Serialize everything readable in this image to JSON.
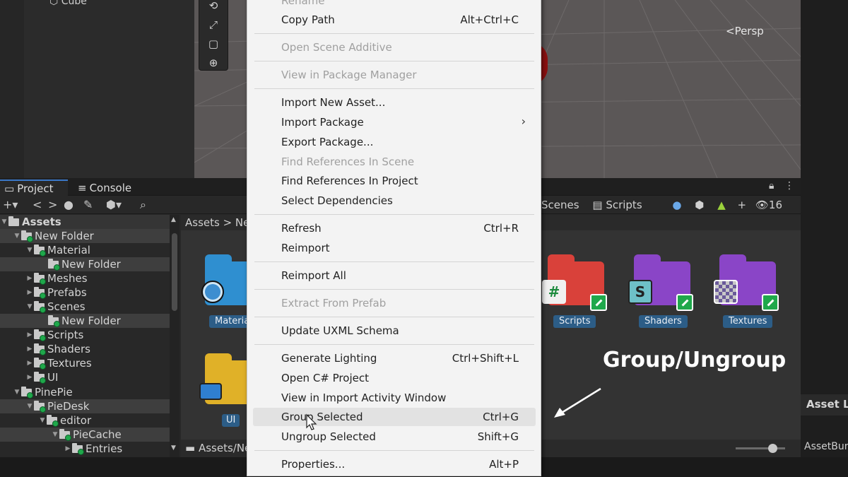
{
  "hierarchy": {
    "object": "Cube"
  },
  "scene": {
    "view_label": "<Persp",
    "tools": [
      "rotate-icon",
      "scale-icon",
      "rect-icon",
      "transform-icon"
    ]
  },
  "tabs": {
    "project": "Project",
    "console": "Console"
  },
  "toolbar": {
    "add": "+▾",
    "back": "<",
    "forward": ">",
    "hidden_count": "16"
  },
  "tree": {
    "items": [
      {
        "label": "Assets"
      },
      {
        "label": "New Folder"
      },
      {
        "label": "Material"
      },
      {
        "label": "New Folder"
      },
      {
        "label": "Meshes"
      },
      {
        "label": "Prefabs"
      },
      {
        "label": "Scenes"
      },
      {
        "label": "New Folder"
      },
      {
        "label": "Scripts"
      },
      {
        "label": "Shaders"
      },
      {
        "label": "Textures"
      },
      {
        "label": "UI"
      },
      {
        "label": "PinePie"
      },
      {
        "label": "PieDesk"
      },
      {
        "label": "editor"
      },
      {
        "label": "PieCache"
      },
      {
        "label": "Entries"
      }
    ]
  },
  "assets": {
    "breadcrumb": "Assets  >  Ne",
    "filters": {
      "scenes": "Scenes",
      "scripts": "Scripts"
    },
    "bottom_path": "Assets/Ne",
    "folders": [
      {
        "label": "Materia",
        "color": "#2f8fd0"
      },
      {
        "label": "Scripts",
        "color": "#d9413a"
      },
      {
        "label": "Shaders",
        "color": "#8a45c7"
      },
      {
        "label": "Textures",
        "color": "#8a45c7"
      },
      {
        "label": "UI",
        "color": "#e0b128"
      }
    ]
  },
  "inspector": {
    "header": "Asset L",
    "bundle": "AssetBun"
  },
  "annotation": "Group/Ungroup",
  "menu": {
    "items": [
      {
        "label": "Rename",
        "shortcut": "",
        "disabled": true
      },
      {
        "label": "Copy Path",
        "shortcut": "Alt+Ctrl+C",
        "disabled": false
      },
      {
        "label": "Open Scene Additive",
        "shortcut": "",
        "disabled": true
      },
      {
        "label": "View in Package Manager",
        "shortcut": "",
        "disabled": true
      },
      {
        "label": "Import New Asset...",
        "shortcut": "",
        "disabled": false
      },
      {
        "label": "Import Package",
        "shortcut": "",
        "disabled": false,
        "submenu": true
      },
      {
        "label": "Export Package...",
        "shortcut": "",
        "disabled": false
      },
      {
        "label": "Find References In Scene",
        "shortcut": "",
        "disabled": true
      },
      {
        "label": "Find References In Project",
        "shortcut": "",
        "disabled": false
      },
      {
        "label": "Select Dependencies",
        "shortcut": "",
        "disabled": false
      },
      {
        "label": "Refresh",
        "shortcut": "Ctrl+R",
        "disabled": false
      },
      {
        "label": "Reimport",
        "shortcut": "",
        "disabled": false
      },
      {
        "label": "Reimport All",
        "shortcut": "",
        "disabled": false
      },
      {
        "label": "Extract From Prefab",
        "shortcut": "",
        "disabled": true
      },
      {
        "label": "Update UXML Schema",
        "shortcut": "",
        "disabled": false
      },
      {
        "label": "Generate Lighting",
        "shortcut": "Ctrl+Shift+L",
        "disabled": false
      },
      {
        "label": "Open C# Project",
        "shortcut": "",
        "disabled": false
      },
      {
        "label": "View in Import Activity Window",
        "shortcut": "",
        "disabled": false
      },
      {
        "label": "Group Selected",
        "shortcut": "Ctrl+G",
        "disabled": false,
        "hover": true
      },
      {
        "label": "Ungroup Selected",
        "shortcut": "Shift+G",
        "disabled": false
      },
      {
        "label": "Properties...",
        "shortcut": "Alt+P",
        "disabled": false
      }
    ]
  }
}
